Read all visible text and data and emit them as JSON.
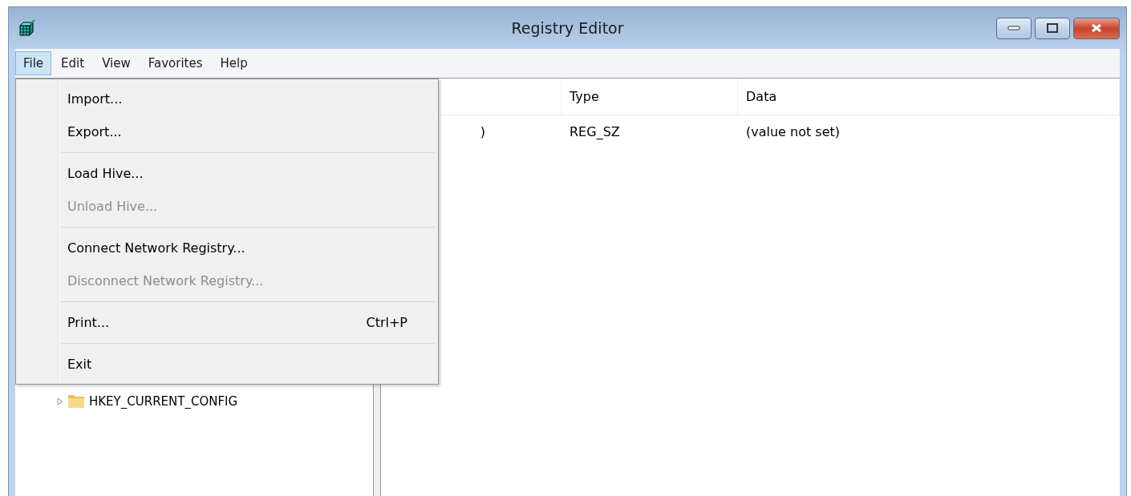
{
  "window": {
    "title": "Registry Editor"
  },
  "menu_bar": [
    {
      "label": "File",
      "selected": true
    },
    {
      "label": "Edit",
      "selected": false
    },
    {
      "label": "View",
      "selected": false
    },
    {
      "label": "Favorites",
      "selected": false
    },
    {
      "label": "Help",
      "selected": false
    }
  ],
  "file_menu": [
    {
      "kind": "item",
      "label": "Import...",
      "disabled": false
    },
    {
      "kind": "item",
      "label": "Export...",
      "disabled": false
    },
    {
      "kind": "separator"
    },
    {
      "kind": "item",
      "label": "Load Hive...",
      "disabled": false
    },
    {
      "kind": "item",
      "label": "Unload Hive...",
      "disabled": true
    },
    {
      "kind": "separator"
    },
    {
      "kind": "item",
      "label": "Connect Network Registry...",
      "disabled": false
    },
    {
      "kind": "item",
      "label": "Disconnect Network Registry...",
      "disabled": true
    },
    {
      "kind": "separator"
    },
    {
      "kind": "item",
      "label": "Print...",
      "shortcut": "Ctrl+P",
      "disabled": false
    },
    {
      "kind": "separator"
    },
    {
      "kind": "item",
      "label": "Exit",
      "disabled": false
    }
  ],
  "tree": {
    "items": [
      {
        "label": "HKEY_CURRENT_CONFIG",
        "expanded": false
      }
    ]
  },
  "table": {
    "columns": [
      "Type",
      "Data"
    ],
    "rows": [
      {
        "name": ")",
        "type": "REG_SZ",
        "data": "(value not set)"
      }
    ]
  }
}
